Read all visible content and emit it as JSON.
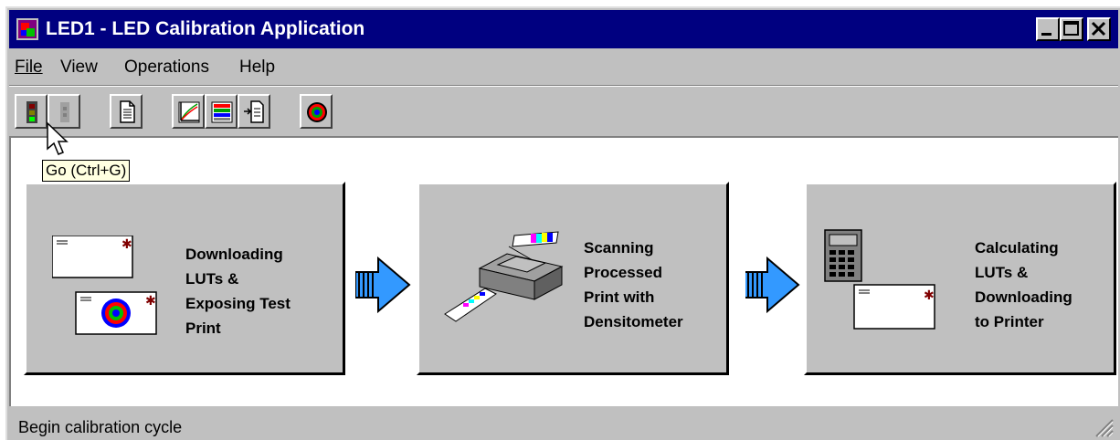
{
  "window": {
    "title": "LED1 - LED Calibration Application",
    "controls": {
      "minimize": "minimize-icon",
      "maximize": "maximize-icon",
      "close": "close-icon"
    }
  },
  "menu": {
    "file": "File",
    "view": "View",
    "operations": "Operations",
    "help": "Help"
  },
  "toolbar": {
    "buttons": [
      "traffic-light-go-icon",
      "traffic-light-stop-icon",
      "document-icon",
      "curve-graph-icon",
      "color-table-icon",
      "download-document-icon",
      "target-icon"
    ]
  },
  "tooltip": {
    "text": "Go (Ctrl+G)"
  },
  "steps": [
    {
      "lines": [
        "Downloading",
        "LUTs &",
        "Exposing Test",
        "Print"
      ],
      "icon": "test-print-icon"
    },
    {
      "lines": [
        "Scanning",
        "Processed",
        "Print with",
        "Densitometer"
      ],
      "icon": "densitometer-icon"
    },
    {
      "lines": [
        "Calculating",
        "LUTs &",
        "Downloading",
        "to Printer"
      ],
      "icon": "calculator-icon"
    }
  ],
  "colors": {
    "title_bar": "#000080",
    "arrow": "#3399ff",
    "face": "#c0c0c0"
  },
  "status": {
    "text": "Begin calibration cycle"
  }
}
